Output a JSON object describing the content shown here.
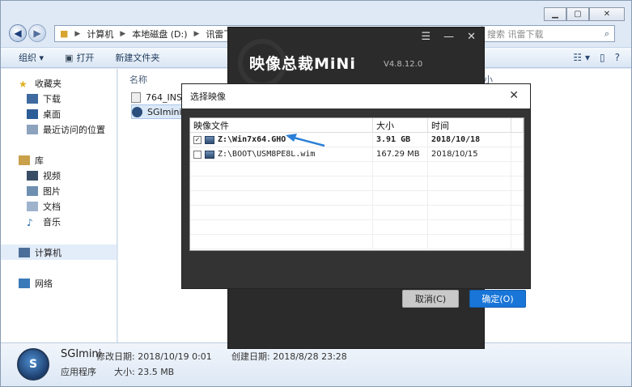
{
  "explorer": {
    "address": [
      "计算机",
      "本地磁盘 (D:)",
      "讯雷下载"
    ],
    "search_placeholder": "搜索 讯雷下载",
    "toolbar": {
      "organize": "组织 ▾",
      "open": "打开",
      "new_folder": "新建文件夹"
    },
    "column_name": "名称",
    "column_size_partial": "小",
    "files": [
      "764_INST",
      "SGImini"
    ],
    "sidebar": {
      "favorites": "收藏夹",
      "downloads": "下载",
      "desktop": "桌面",
      "recent": "最近访问的位置",
      "library": "库",
      "videos": "视频",
      "pictures": "图片",
      "documents": "文档",
      "music": "音乐",
      "computer": "计算机",
      "network": "网络"
    },
    "status": {
      "name": "SGImini",
      "type": "应用程序",
      "modified": "修改日期: 2018/10/19 0:01",
      "created": "创建日期: 2018/8/28 23:28",
      "size": "大小: 23.5 MB"
    }
  },
  "app": {
    "title_cn": "映像总裁",
    "title_en": "MiNi",
    "version": "V4.8.12.0",
    "controls": [
      "☰",
      "—",
      "✕"
    ]
  },
  "dialog": {
    "title": "选择映像",
    "close": "✕",
    "columns": [
      "映像文件",
      "大小",
      "时间"
    ],
    "rows": [
      {
        "checked": true,
        "file": "Z:\\Win7x64.GHO",
        "size": "3.91 GB",
        "date": "2018/10/18"
      },
      {
        "checked": false,
        "file": "Z:\\BOOT\\USM8PE8L.wim",
        "size": "167.29 MB",
        "date": "2018/10/15"
      }
    ],
    "cancel": "取消(C)",
    "ok": "确定(O)"
  }
}
